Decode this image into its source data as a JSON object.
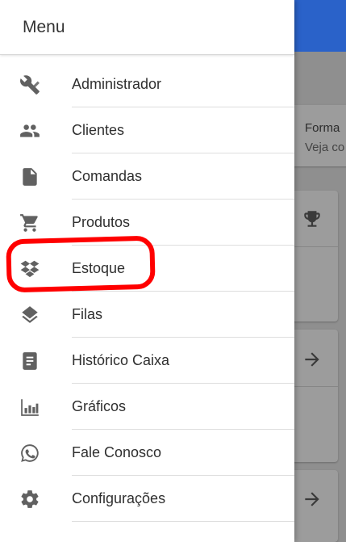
{
  "app": {
    "card_title": "Forma",
    "card_subtitle": "Veja co"
  },
  "drawer": {
    "title": "Menu",
    "items": [
      {
        "label": "Administrador",
        "icon": "tools-icon"
      },
      {
        "label": "Clientes",
        "icon": "people-icon"
      },
      {
        "label": "Comandas",
        "icon": "file-icon"
      },
      {
        "label": "Produtos",
        "icon": "cart-icon"
      },
      {
        "label": "Estoque",
        "icon": "dropbox-icon"
      },
      {
        "label": "Filas",
        "icon": "layers-icon"
      },
      {
        "label": "Histórico Caixa",
        "icon": "document-icon"
      },
      {
        "label": "Gráficos",
        "icon": "bar-chart-icon"
      },
      {
        "label": "Fale Conosco",
        "icon": "whatsapp-icon"
      },
      {
        "label": "Configurações",
        "icon": "gear-icon"
      }
    ]
  },
  "annotation": {
    "highlighted_item": "Estoque",
    "color": "#ff0000"
  },
  "colors": {
    "app_bar": "#2a62c9",
    "icon": "#616161",
    "overlay": "#8f8f8f"
  }
}
